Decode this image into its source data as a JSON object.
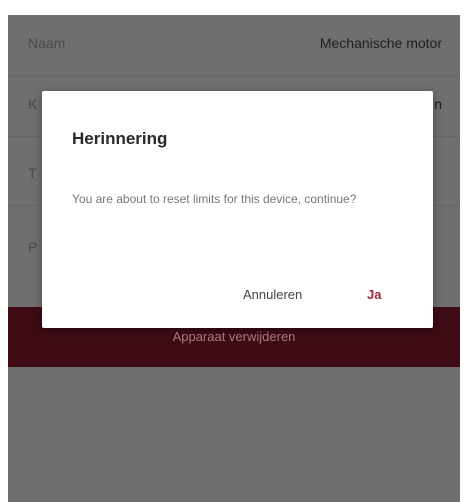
{
  "background_rows": [
    {
      "label": "Naam",
      "value": "Mechanische motor"
    },
    {
      "label": "K",
      "value": "n"
    },
    {
      "label": "T",
      "value": ""
    },
    {
      "label": "P",
      "value": ""
    }
  ],
  "delete_button": {
    "label": "Apparaat verwijderen"
  },
  "dialog": {
    "title": "Herinnering",
    "message": "You are about to reset limits for this device, continue?",
    "cancel_label": "Annuleren",
    "confirm_label": "Ja"
  },
  "colors": {
    "overlay": "#6f6f6f",
    "delete_bar": "#3e0a14",
    "confirm_accent": "#a3243a",
    "dialog_bg": "#ffffff"
  }
}
